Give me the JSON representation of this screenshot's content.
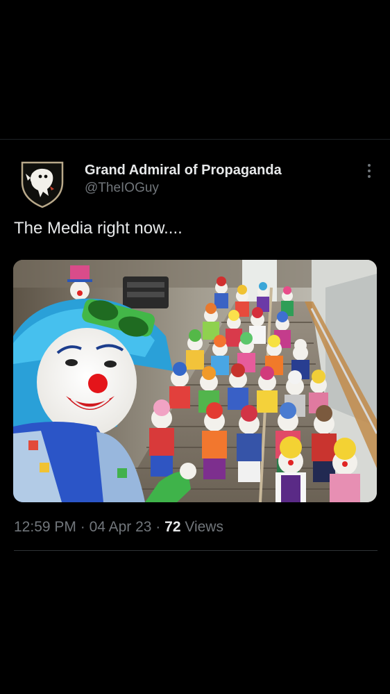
{
  "tweet": {
    "author": {
      "display_name": "Grand Admiral of Propaganda",
      "handle": "@TheIOGuy",
      "avatar_icon": "shield-ghost-icon"
    },
    "text": "The Media right now....",
    "media": {
      "kind": "photo"
    },
    "meta": {
      "time": "12:59 PM",
      "separator": " · ",
      "date": "04 Apr 23",
      "views_count": "72",
      "views_label": " Views"
    },
    "more_icon": "more-vertical-icon"
  },
  "colors": {
    "background": "#000000",
    "primary_text": "#e7e9ea",
    "secondary_text": "#71767b",
    "divider": "#2f3336"
  }
}
